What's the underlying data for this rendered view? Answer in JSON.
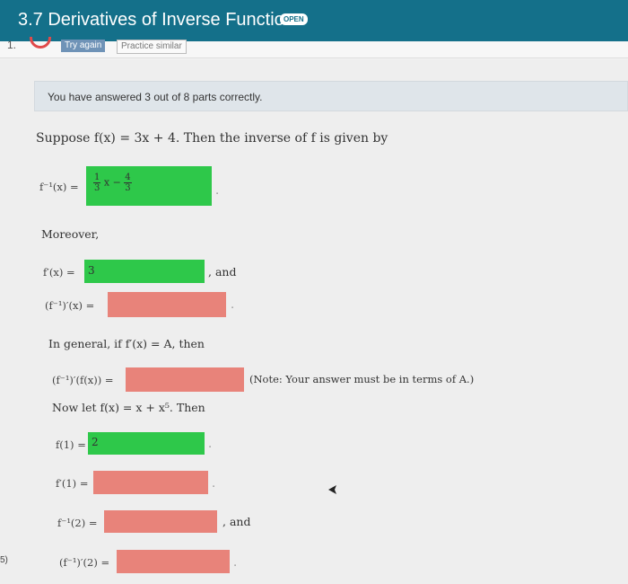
{
  "header": {
    "title": "3.7 Derivatives of Inverse Functions",
    "badge": "OPEN"
  },
  "question": {
    "number": "1.",
    "try_again": "Try again",
    "practice_similar": "Practice similar"
  },
  "alert": "You have answered 3 out of 8 parts correctly.",
  "prompt": "Suppose f(x) = 3x + 4. Then the inverse of f is given by",
  "inverse": {
    "label": "f⁻¹(x) =",
    "answer": {
      "coef_num": "1",
      "coef_den": "3",
      "var": "x −",
      "const_num": "4",
      "const_den": "3"
    },
    "status": "correct"
  },
  "moreover": "Moreover,",
  "derivative": {
    "label": "f′(x) =",
    "value": "3",
    "status": "correct",
    "suffix": ", and"
  },
  "inv_derivative": {
    "label": "(f⁻¹)′(x) =",
    "value": "",
    "status": "incorrect"
  },
  "general": "In general, if f′(x) = A, then",
  "general_inv": {
    "label": "(f⁻¹)′(f(x)) =",
    "value": "",
    "status": "incorrect",
    "note": "(Note: Your answer must be in terms of A.)"
  },
  "now_let": "Now let f(x) = x + x⁵. Then",
  "f_of_1": {
    "label": "f(1) =",
    "value": "2",
    "status": "correct"
  },
  "fprime_of_1": {
    "label": "f′(1) =",
    "value": "",
    "status": "incorrect"
  },
  "finv_of_2": {
    "label": "f⁻¹(2) =",
    "value": "",
    "status": "incorrect",
    "suffix": ", and"
  },
  "finvprime_of_2": {
    "label": "(f⁻¹)′(2) =",
    "value": "",
    "status": "incorrect"
  },
  "edge_text": "5)",
  "colors": {
    "header": "#14708a",
    "correct": "#2ec84a",
    "incorrect": "#e8837a",
    "alert": "#dfe5ea"
  }
}
